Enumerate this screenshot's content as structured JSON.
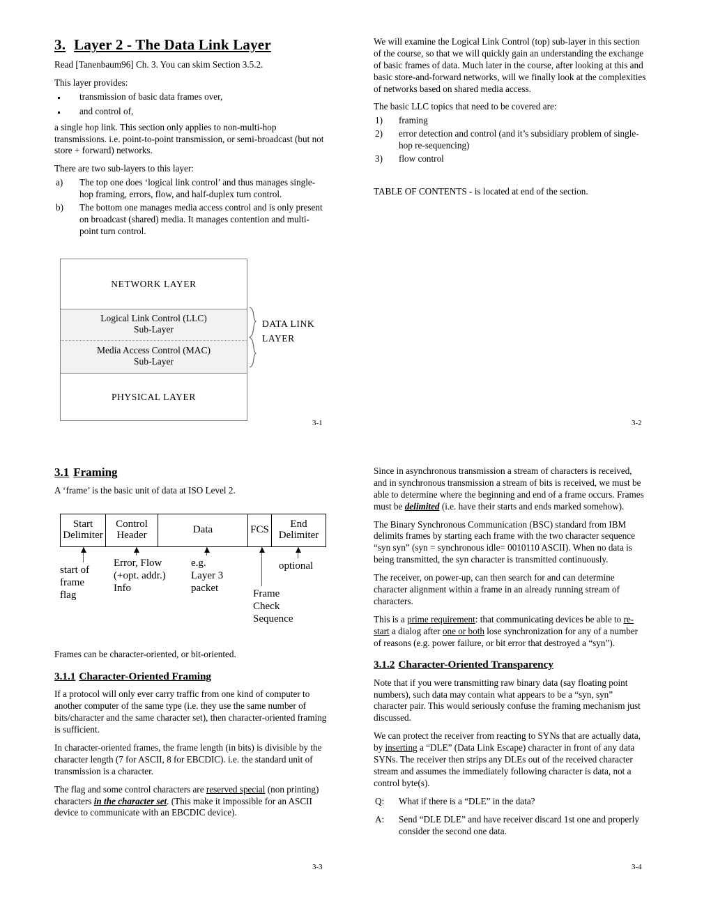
{
  "doc": {
    "title": "Layer 2 - The Data Link Layer",
    "title_number": "3."
  },
  "slide_3_1": {
    "page_number": "3-1",
    "read_line": "Read [Tanenbaum96] Ch. 3.  You can skim Section 3.5.2.",
    "provides_intro": "This layer provides:",
    "bullets": [
      "transmission of basic data frames over,",
      "and control of,"
    ],
    "hop_para": "a single hop link.  This section only applies to non-multi-hop transmissions.  i.e. point-to-point transmission, or semi-broadcast (but not store + forward) networks.",
    "sublayers_intro": "There are two sub-layers to this layer:",
    "sublayers": [
      {
        "marker": "a)",
        "text": "The top one does ‘logical link control’ and thus manages single-hop framing, errors, flow, and half-duplex turn control."
      },
      {
        "marker": "b)",
        "text": "The bottom one manages media access control and is only present on broadcast (shared) media.  It manages contention and multi-point turn control."
      }
    ],
    "layer_diagram": {
      "network_layer": "NETWORK  LAYER",
      "llc_line1": "Logical Link Control (LLC)",
      "llc_line2": "Sub-Layer",
      "mac_line1": "Media Access Control (MAC)",
      "mac_line2": "Sub-Layer",
      "physical_layer": "PHYSICAL  LAYER",
      "brace_label_line1": "DATA  LINK",
      "brace_label_line2": "LAYER"
    }
  },
  "slide_3_2": {
    "page_number": "3-2",
    "para1": "We will examine the Logical Link Control (top) sub-layer in this section of the course, so that we will quickly gain an understanding the exchange of basic frames of data.  Much later in the course, after looking at this and basic store-and-forward networks, will we finally look at the complexities of networks based on shared media access.",
    "topics_intro": "The basic LLC topics that need to be covered are:",
    "topics": [
      {
        "marker": "1)",
        "text": "framing"
      },
      {
        "marker": "2)",
        "text": "error detection and control (and it’s subsidiary problem of single-hop re-sequencing)"
      },
      {
        "marker": "3)",
        "text": "flow control"
      }
    ],
    "toc_note": "TABLE OF CONTENTS - is located at end of the section."
  },
  "slide_3_3": {
    "page_number": "3-3",
    "heading_number": "3.1",
    "heading_text": "Framing",
    "frame_intro": "A ‘frame’ is the basic unit of data at ISO Level 2.",
    "frame_cells": [
      "Start Delimiter",
      "Control Header",
      "Data",
      "FCS",
      "End Delimiter"
    ],
    "frame_cell_lines": {
      "start": [
        "Start",
        "Delimiter"
      ],
      "control": [
        "Control",
        "Header"
      ],
      "data": [
        "Data"
      ],
      "fcs": [
        "FCS"
      ],
      "end": [
        "End",
        "Delimiter"
      ]
    },
    "annotations": [
      {
        "lines": [
          "start of",
          "frame",
          "flag"
        ]
      },
      {
        "lines": [
          "Error, Flow",
          "(+opt. addr.)",
          "Info"
        ]
      },
      {
        "lines": [
          "e.g.",
          "Layer 3",
          "packet"
        ]
      },
      {
        "lines": [
          "Frame",
          "Check",
          "Sequence"
        ]
      },
      {
        "lines": [
          "optional"
        ]
      }
    ],
    "frames_oriented": "Frames can be character-oriented, or bit-oriented.",
    "subsection_number": "3.1.1",
    "subsection_title": "Character-Oriented Framing",
    "para1": "If a protocol will only ever carry traffic from one kind of computer to another computer of the same type (i.e. they use the same number of bits/character and the same character set), then character-oriented framing is sufficient.",
    "para2": "In character-oriented frames, the frame length (in bits) is divisible by the character length (7 for ASCII, 8 for EBCDIC). i.e. the standard unit of transmission is a character.",
    "para3_a": "The flag and some control characters are ",
    "para3_underline": "reserved special",
    "para3_b": " (non printing) characters ",
    "para3_biu": "in the character set",
    "para3_c": ". (This make it impossible for an ASCII device to communicate with an EBCDIC device)."
  },
  "slide_3_4": {
    "page_number": "3-4",
    "para1_a": "Since in asynchronous transmission a stream of characters is received, and in synchronous transmission a stream of bits is received, we must be able to determine where the beginning and end of a frame occurs.  Frames must be ",
    "para1_biu": "delimited",
    "para1_b": " (i.e. have their starts and ends marked somehow).",
    "para2": "The Binary Synchronous Communication (BSC) standard from IBM delimits frames by starting each frame with the two character sequence “syn syn” (syn = synchronous idle= 0010110 ASCII).  When no data is being transmitted, the syn character is transmitted continuously.",
    "para3": "The receiver, on power-up, can then search for and can determine character alignment within a frame in an already running stream of characters.",
    "para4_a": "This is a ",
    "para4_u1": "prime requirement",
    "para4_b": ":  that communicating devices be able to ",
    "para4_u2": "re-start",
    "para4_c": " a dialog after ",
    "para4_u3": "one or both",
    "para4_d": " lose synchronization for any of a number of reasons (e.g. power failure, or bit error that destroyed a “syn”).",
    "subsection_number": "3.1.2",
    "subsection_title": "Character-Oriented Transparency",
    "para5": "Note that if you were transmitting raw binary data (say floating point numbers), such data may contain what appears to be a “syn, syn” character pair.  This would seriously confuse the framing mechanism just discussed.",
    "para6_a": "We can protect the receiver from reacting to SYNs that are actually data, by ",
    "para6_u": "inserting",
    "para6_b": " a “DLE” (Data Link Escape) character in front of any data SYNs.  The receiver then strips any DLEs out of the received character stream and assumes the immediately following character is data, not a control byte(s).",
    "qa": [
      {
        "marker": "Q:",
        "text": "What if there is a “DLE” in the data?"
      },
      {
        "marker": "A:",
        "text": "Send “DLE DLE” and have receiver discard 1st one and properly consider the second one data."
      }
    ]
  }
}
